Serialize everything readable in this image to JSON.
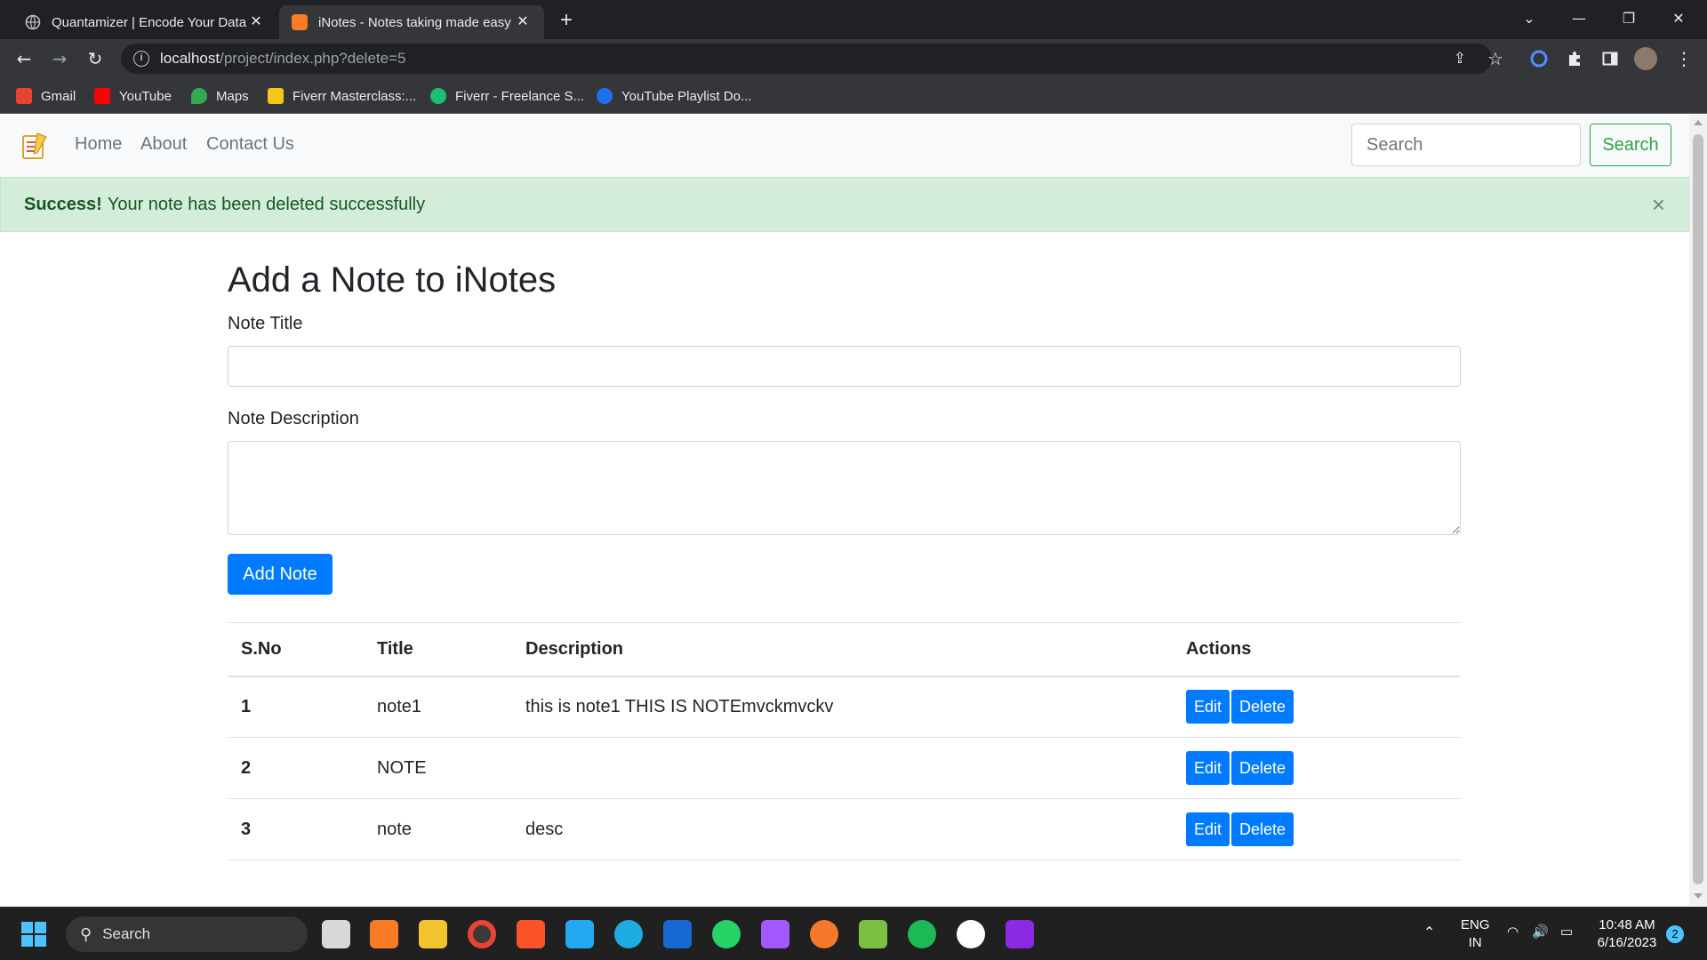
{
  "browser": {
    "tabs": [
      {
        "title": "Quantamizer | Encode Your Data",
        "active": false
      },
      {
        "title": "iNotes - Notes taking made easy",
        "active": true
      }
    ],
    "url_host": "localhost",
    "url_path": "/project/index.php?delete=5",
    "bookmarks": [
      {
        "label": "Gmail",
        "color": "#ea4335"
      },
      {
        "label": "YouTube",
        "color": "#ff0000"
      },
      {
        "label": "Maps",
        "color": "#34a853"
      },
      {
        "label": "Fiverr Masterclass:...",
        "color": "#f5c518"
      },
      {
        "label": "Fiverr - Freelance S...",
        "color": "#1dbf73"
      },
      {
        "label": "YouTube Playlist Do...",
        "color": "#1a73e8"
      }
    ]
  },
  "navbar": {
    "links": [
      "Home",
      "About",
      "Contact Us"
    ],
    "search_placeholder": "Search",
    "search_button": "Search"
  },
  "alert": {
    "strong": "Success!",
    "message": "Your note has been deleted successfully",
    "close": "×"
  },
  "form": {
    "heading": "Add a Note to iNotes",
    "title_label": "Note Title",
    "description_label": "Note Description",
    "submit_label": "Add Note"
  },
  "table": {
    "headers": [
      "S.No",
      "Title",
      "Description",
      "Actions"
    ],
    "rows": [
      {
        "sno": "1",
        "title": "note1",
        "description": "this is note1 THIS IS NOTEmvckmvckv"
      },
      {
        "sno": "2",
        "title": "NOTE",
        "description": ""
      },
      {
        "sno": "3",
        "title": "note",
        "description": "desc"
      }
    ],
    "edit_label": "Edit",
    "delete_label": "Delete"
  },
  "taskbar": {
    "search_label": "Search",
    "lang_top": "ENG",
    "lang_bottom": "IN",
    "time": "10:48 AM",
    "date": "6/16/2023",
    "notification_count": "2"
  },
  "colors": {
    "primary": "#007bff",
    "success": "#28a745",
    "alert_bg": "#d4edda",
    "alert_text": "#155724"
  }
}
